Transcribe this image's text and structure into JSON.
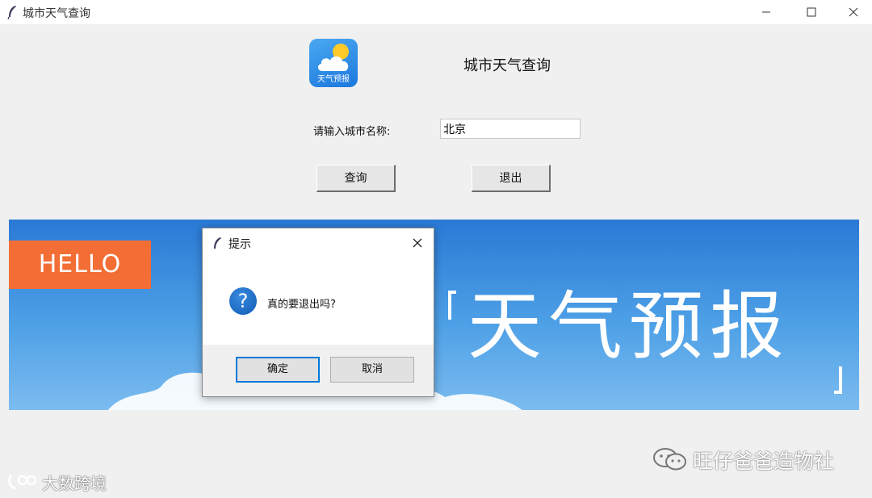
{
  "window": {
    "title": "城市天气查询",
    "controls": [
      "minimize-icon",
      "maximize-icon",
      "close-icon"
    ]
  },
  "app": {
    "icon_text": "天气预报",
    "heading": "城市天气查询",
    "city_label": "请输入城市名称:",
    "city_value": "北京",
    "query_button": "查询",
    "exit_button": "退出"
  },
  "banner": {
    "hello": "HELLO",
    "title": "天气预报",
    "colors": {
      "sky_top": "#2a79d6",
      "sky_bottom": "#7cbcf0",
      "hello_bg": "#f26e35"
    }
  },
  "dialog": {
    "title": "提示",
    "message": "真的要退出吗?",
    "icon": "question-icon",
    "ok_label": "确定",
    "cancel_label": "取消"
  },
  "watermarks": {
    "right": "旺仔爸爸造物社",
    "left": "大数跨境"
  }
}
